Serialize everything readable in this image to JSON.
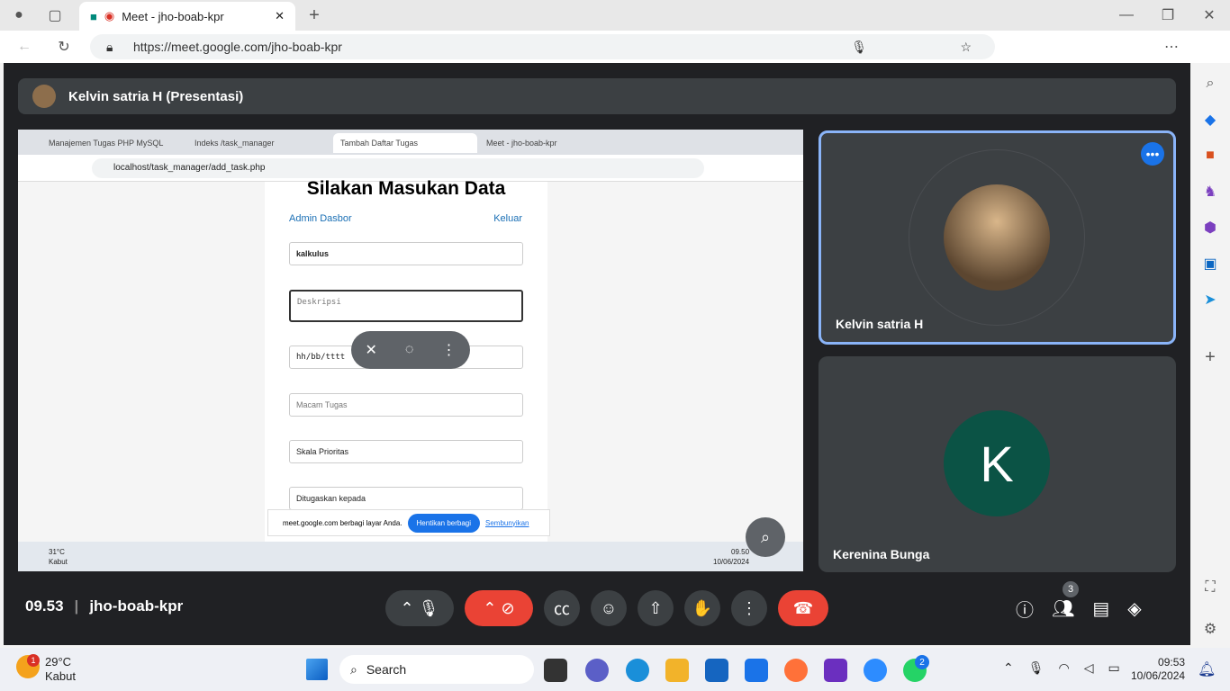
{
  "browser": {
    "tab_title": "Meet - jho-boab-kpr",
    "url": "https://meet.google.com/jho-boab-kpr"
  },
  "meet": {
    "presenter_title": "Kelvin satria H (Presentasi)",
    "participants": [
      {
        "name": "Kelvin satria H"
      },
      {
        "name": "Kerenina Bunga",
        "initial": "K"
      }
    ],
    "time": "09.53",
    "meeting_code": "jho-boab-kpr",
    "people_count": "3"
  },
  "shared": {
    "tabs": [
      "Manajemen Tugas PHP MySQL",
      "Indeks /task_manager",
      "Tambah Daftar Tugas",
      "Meet - jho-boab-kpr"
    ],
    "url": "localhost/task_manager/add_task.php",
    "heading": "Silakan Masukan Data",
    "admin_link": "Admin Dasbor",
    "logout_link": "Keluar",
    "field_title": "kalkulus",
    "field_desc_ph": "Deskripsi",
    "field_date": "hh/bb/tttt",
    "field_type_ph": "Macam Tugas",
    "select_priority": "Skala Prioritas",
    "select_assign": "Ditugaskan kepada",
    "share_notice": "meet.google.com berbagi layar Anda.",
    "stop_share": "Hentikan berbagi",
    "hide": "Sembunyikan",
    "weather_temp": "31°C",
    "weather_desc": "Kabut",
    "clock_time": "09.50",
    "clock_date": "10/06/2024"
  },
  "taskbar": {
    "weather_temp": "29°C",
    "weather_desc": "Kabut",
    "search": "Search",
    "time": "09:53",
    "date": "10/06/2024",
    "weather_badge": "1",
    "whatsapp_badge": "2"
  },
  "colors": {
    "meet_bg": "#202124",
    "accent": "#8ab4f8",
    "end_call": "#ea4335",
    "avatar_green": "#0b5345"
  }
}
